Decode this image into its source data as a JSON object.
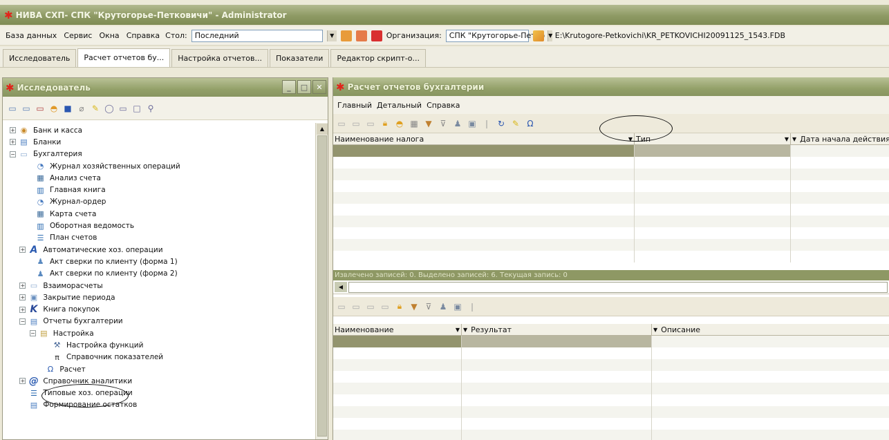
{
  "window": {
    "title": "НИВА СХП- СПК \"Крутогорье-Петковичи\" - Administrator"
  },
  "menu": {
    "items": [
      "База данных",
      "Сервис",
      "Окна",
      "Справка"
    ],
    "stol_label": "Стол:",
    "stol_value": "Последний",
    "org_label": "Организация:",
    "org_value": "СПК \"Крутогорье-Петко",
    "db_path": "E:\\Krutogore-Petkovichi\\KR_PETKOVICHI20091125_1543.FDB"
  },
  "tabs": [
    "Исследователь",
    "Расчет отчетов бу...",
    "Настройка отчетов...",
    "Показатели",
    "Редактор скрипт-о..."
  ],
  "explorer": {
    "title": "Исследователь",
    "tree": [
      {
        "label": "Банк и касса",
        "level": 0,
        "exp": "+",
        "icon": "bank-icon"
      },
      {
        "label": "Бланки",
        "level": 0,
        "exp": "+",
        "icon": "document-icon"
      },
      {
        "label": "Бухгалтерия",
        "level": 0,
        "exp": "−",
        "icon": "folder-icon"
      },
      {
        "label": "Журнал хозяйственных операций",
        "level": 1,
        "exp": "",
        "icon": "journal-icon"
      },
      {
        "label": "Анализ счета",
        "level": 1,
        "exp": "",
        "icon": "grid-icon"
      },
      {
        "label": "Главная книга",
        "level": 1,
        "exp": "",
        "icon": "book-icon"
      },
      {
        "label": "Журнал-ордер",
        "level": 1,
        "exp": "",
        "icon": "journal-icon"
      },
      {
        "label": "Карта счета",
        "level": 1,
        "exp": "",
        "icon": "grid-icon"
      },
      {
        "label": "Оборотная ведомость",
        "level": 1,
        "exp": "",
        "icon": "book-icon"
      },
      {
        "label": "План счетов",
        "level": 1,
        "exp": "",
        "icon": "list-icon"
      },
      {
        "label": "Автоматические хоз. операции",
        "level": 0.6,
        "exp": "+",
        "icon": "script-a-icon"
      },
      {
        "label": "Акт сверки по клиенту (форма 1)",
        "level": 1,
        "exp": "",
        "icon": "people-icon"
      },
      {
        "label": "Акт сверки по клиенту (форма 2)",
        "level": 1,
        "exp": "",
        "icon": "people-icon"
      },
      {
        "label": "Взаиморасчеты",
        "level": 0.6,
        "exp": "+",
        "icon": "folder-icon"
      },
      {
        "label": "Закрытие периода",
        "level": 0.6,
        "exp": "+",
        "icon": "window-icon"
      },
      {
        "label": "Книга покупок",
        "level": 0.6,
        "exp": "+",
        "icon": "k-icon"
      },
      {
        "label": "Отчеты бухгалтерии",
        "level": 0.6,
        "exp": "−",
        "icon": "document-icon"
      },
      {
        "label": "Настройка",
        "level": 1.2,
        "exp": "−",
        "icon": "settings-folder-icon"
      },
      {
        "label": "Настройка функций",
        "level": 2,
        "exp": "",
        "icon": "tools-icon"
      },
      {
        "label": "Справочник показателей",
        "level": 2,
        "exp": "",
        "icon": "pi-icon"
      },
      {
        "label": "Расчет",
        "level": 1.6,
        "exp": "",
        "icon": "omega-icon"
      },
      {
        "label": "Справочник аналитики",
        "level": 0.6,
        "exp": "+",
        "icon": "at-icon"
      },
      {
        "label": "Типовые хоз. операции",
        "level": 0.6,
        "exp": "",
        "icon": "list-icon"
      },
      {
        "label": "Формирование остатков",
        "level": 0.6,
        "exp": "",
        "icon": "document-icon"
      }
    ]
  },
  "calc_panel": {
    "title": "Расчет отчетов бухгалтерии",
    "menu": [
      "Главный",
      "Детальный",
      "Справка"
    ],
    "top_columns": [
      "Наименование налога",
      "Тип",
      "Дата начала действия"
    ],
    "status": "Извлечено записей: 0. Выделено записей: 6. Текущая запись: 0",
    "bottom_columns": [
      "Наименование",
      "Результат",
      "Описание"
    ]
  },
  "colors": {
    "title_green": "#8e9a64",
    "accent_red": "#e2231a"
  }
}
